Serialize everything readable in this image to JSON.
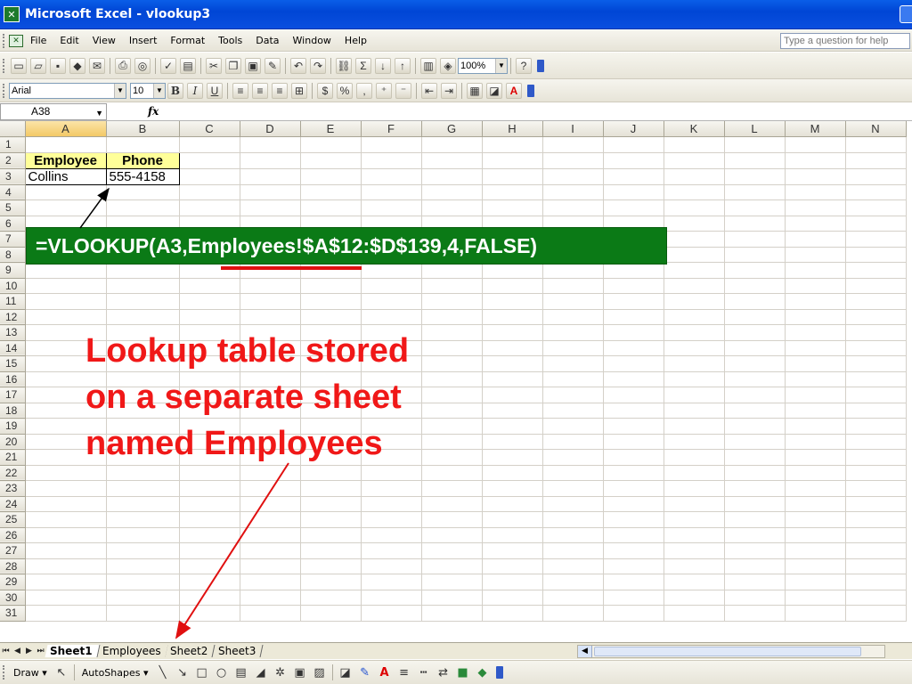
{
  "window": {
    "title": "Microsoft Excel - vlookup3"
  },
  "menu": {
    "items": [
      "File",
      "Edit",
      "View",
      "Insert",
      "Format",
      "Tools",
      "Data",
      "Window",
      "Help"
    ],
    "help_placeholder": "Type a question for help"
  },
  "toolbar": {
    "zoom": "100%"
  },
  "format_toolbar": {
    "font": "Arial",
    "size": "10",
    "bold": "B",
    "italic": "I",
    "underline": "U",
    "currency": "$",
    "percent": "%",
    "comma": ","
  },
  "formula_bar": {
    "name_box": "A38",
    "fx": "fx"
  },
  "columns": [
    "A",
    "B",
    "C",
    "D",
    "E",
    "F",
    "G",
    "H",
    "I",
    "J",
    "K",
    "L",
    "M",
    "N"
  ],
  "cells": {
    "A2": "Employee",
    "B2": "Phone",
    "A3": "Collins",
    "B3": "555-4158"
  },
  "annotations": {
    "formula": "=VLOOKUP(A3,Employees!$A$12:$D$139,4,FALSE)",
    "note_lines": [
      "Lookup table stored",
      "on a separate sheet",
      "named Employees"
    ]
  },
  "sheet_tabs": [
    "Sheet1",
    "Employees",
    "Sheet2",
    "Sheet3"
  ],
  "active_sheet": "Sheet1",
  "drawing_toolbar": {
    "draw": "Draw",
    "autoshapes": "AutoShapes"
  },
  "colors": {
    "callout_bg": "#0b7a16",
    "note_text": "#f01818",
    "arrow": "#e01010",
    "header_fill": "#ffff99"
  }
}
